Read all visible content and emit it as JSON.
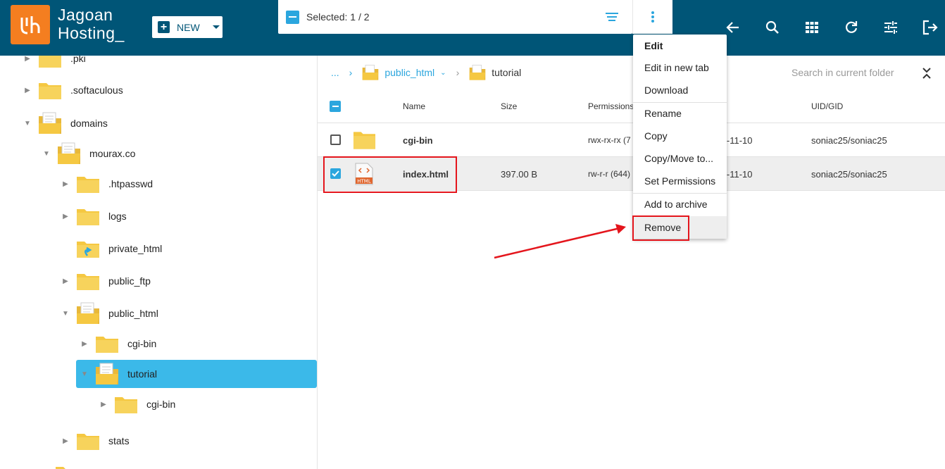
{
  "brand": {
    "line1": "Jagoan",
    "line2": "Hosting_"
  },
  "toolbar": {
    "new_label": "NEW",
    "selected_text": "Selected: 1 / 2"
  },
  "tree": [
    {
      "label": ".pki",
      "indent": 0
    },
    {
      "label": ".softaculous",
      "indent": 0
    },
    {
      "label": "domains",
      "indent": 0
    },
    {
      "label": "mourax.co",
      "indent": 1
    },
    {
      "label": ".htpasswd",
      "indent": 2
    },
    {
      "label": "logs",
      "indent": 2
    },
    {
      "label": "private_html",
      "indent": 2
    },
    {
      "label": "public_ftp",
      "indent": 2
    },
    {
      "label": "public_html",
      "indent": 2
    },
    {
      "label": "cgi-bin",
      "indent": 3
    },
    {
      "label": "tutorial",
      "indent": 3
    },
    {
      "label": "cgi-bin",
      "indent": 4
    },
    {
      "label": "stats",
      "indent": 2
    }
  ],
  "breadcrumb": {
    "ellipsis": "...",
    "parent": "public_html",
    "current": "tutorial"
  },
  "search": {
    "placeholder": "Search in current folder"
  },
  "table": {
    "headers": {
      "name": "Name",
      "size": "Size",
      "permissions": "Permissions",
      "uid": "UID/GID"
    },
    "rows": [
      {
        "name": "cgi-bin",
        "size": "",
        "permissions": "rwx-rx-rx (7",
        "date": "l-11-10",
        "uid": "soniac25/soniac25",
        "selected": false
      },
      {
        "name": "index.html",
        "size": "397.00 B",
        "permissions": "rw-r-r (644)",
        "date": "l-11-10",
        "uid": "soniac25/soniac25",
        "selected": true
      }
    ]
  },
  "menu": {
    "edit": "Edit",
    "edit_new_tab": "Edit in new tab",
    "download": "Download",
    "rename": "Rename",
    "copy": "Copy",
    "copy_move": "Copy/Move to...",
    "set_permissions": "Set Permissions",
    "add_archive": "Add to archive",
    "remove": "Remove"
  },
  "icons": {
    "back": "arrow-left-icon",
    "search": "search-icon",
    "grid": "grid-icon",
    "refresh": "refresh-icon",
    "settings": "sliders-icon",
    "logout": "logout-icon"
  },
  "colors": {
    "header": "#005577",
    "accent": "#2ba6de",
    "brand": "#f47e20",
    "highlight": "#e4151c",
    "folder": "#f5c842"
  }
}
